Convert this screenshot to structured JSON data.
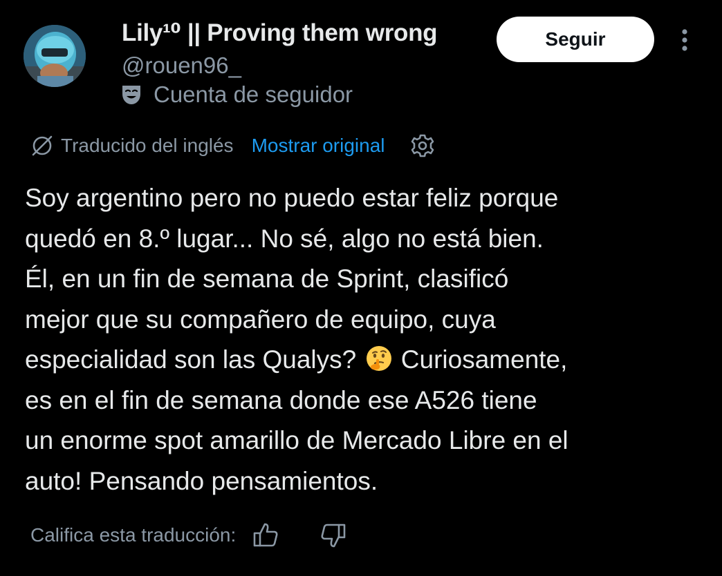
{
  "author": {
    "display_name": "Lily¹⁰ || Proving them wrong",
    "handle": "@rouen96_",
    "account_type": "Cuenta de seguidor",
    "account_type_icon": "theater-mask-icon"
  },
  "follow_label": "Seguir",
  "more_icon": "more-vertical-icon",
  "translation": {
    "label": "Traducido del inglés",
    "show_original": "Mostrar original"
  },
  "tweet": {
    "lines": [
      "Soy argentino pero no puedo estar feliz porque",
      "quedó en 8.º lugar... No sé, algo no está bien.",
      "Él, en un fin de semana de Sprint, clasificó",
      "mejor que su compañero de equipo, cuya",
      "especialidad son las Qualys?",
      "Curiosamente,",
      "es en el fin de semana donde ese A526 tiene",
      "un enorme spot amarillo de Mercado Libre en el",
      "auto! Pensando pensamientos."
    ],
    "emoji": "thinking-face-emoji"
  },
  "rating": {
    "label": "Califica esta traducción:"
  },
  "colors": {
    "background": "#000000",
    "text": "#e7e9ea",
    "secondary": "#8b98a5",
    "accent": "#1d9bf0",
    "button_bg": "#ffffff"
  }
}
